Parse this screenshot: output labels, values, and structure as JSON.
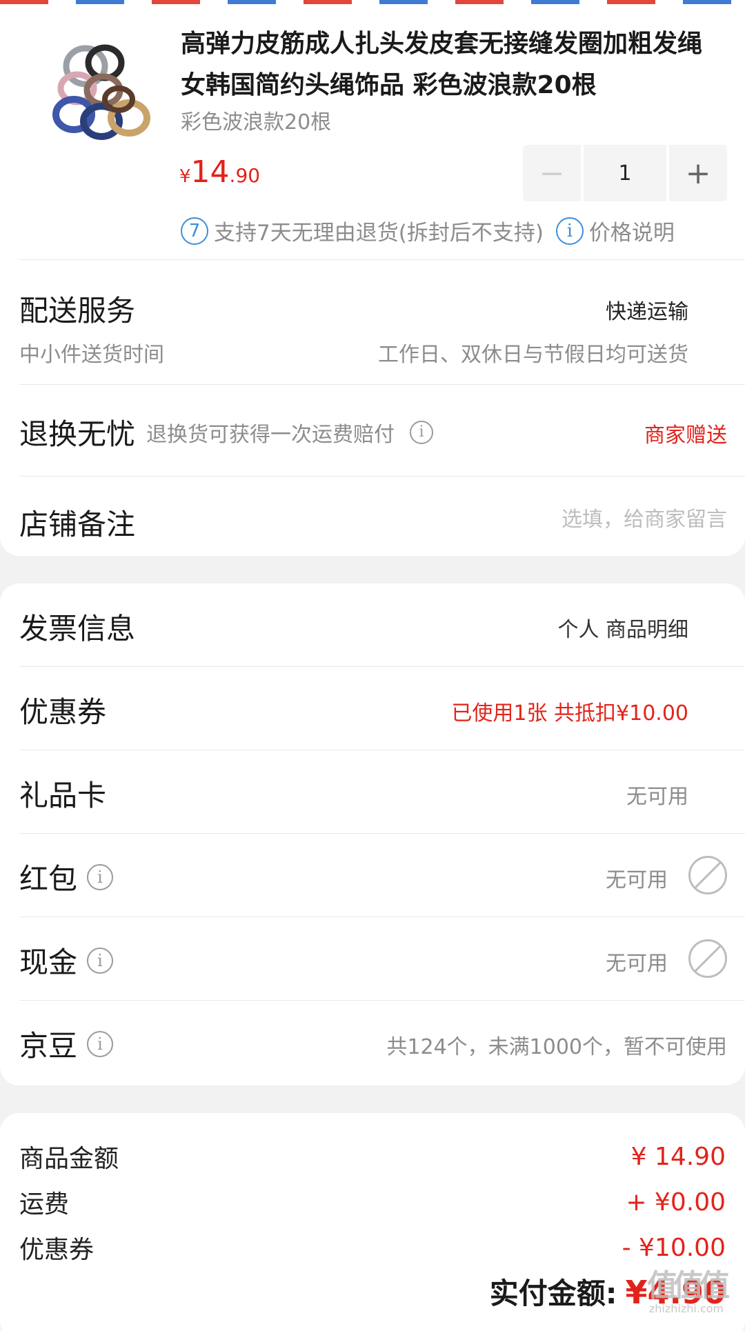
{
  "product": {
    "title": "高弹力皮筋成人扎头发皮套无接缝发圈加粗发绳女韩国简约头绳饰品 彩色波浪款20根",
    "variant": "彩色波浪款20根",
    "price_currency": "¥",
    "price_int": "14",
    "price_dec": ".90",
    "quantity": "1",
    "minus_symbol": "−",
    "plus_symbol": "+",
    "return_badge": "7",
    "return_note": "支持7天无理由退货(拆封后不支持)",
    "price_note": "价格说明"
  },
  "delivery": {
    "label": "配送服务",
    "value": "快递运输",
    "sub_label": "中小件送货时间",
    "sub_value": "工作日、双休日与节假日均可送货"
  },
  "returns": {
    "label": "退换无忧",
    "desc": "退换货可获得一次运费赔付",
    "value": "商家赠送"
  },
  "remark": {
    "label": "店铺备注",
    "placeholder": "选填，给商家留言"
  },
  "payment_options": [
    {
      "label": "发票信息",
      "value": "个人 商品明细"
    },
    {
      "label": "优惠券",
      "value": "已使用1张 共抵扣¥10.00"
    },
    {
      "label": "礼品卡",
      "value": "无可用"
    },
    {
      "label": "红包",
      "value": "无可用"
    },
    {
      "label": "现金",
      "value": "无可用"
    },
    {
      "label": "京豆",
      "value": "共124个，未满1000个，暂不可使用"
    }
  ],
  "summary": {
    "rows": [
      {
        "label": "商品金额",
        "value": "¥ 14.90"
      },
      {
        "label": "运费",
        "value": "+ ¥0.00"
      },
      {
        "label": "优惠券",
        "value": "- ¥10.00"
      }
    ],
    "total_label": "实付金额:",
    "total_value": "¥4.90"
  },
  "watermark": {
    "text": "值值值",
    "sub": "zhizhizhi.com"
  },
  "colors": {
    "accent_red": "#e2231a",
    "info_blue": "#3c8ed8",
    "muted": "#8c8c8c"
  },
  "icons": [
    "thumb-image",
    "minus-icon",
    "plus-icon",
    "return-7-icon",
    "info-icon",
    "disabled-icon"
  ]
}
